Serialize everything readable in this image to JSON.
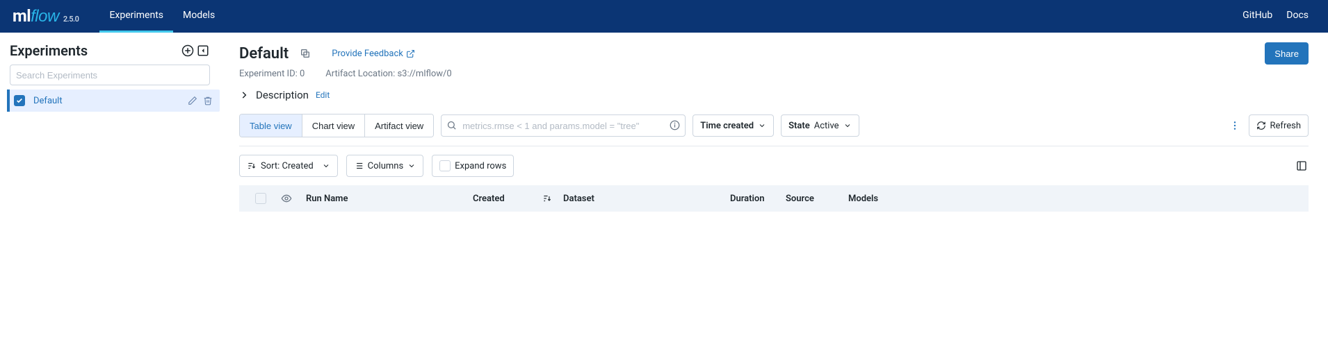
{
  "nav": {
    "version": "2.5.0",
    "tabs": [
      "Experiments",
      "Models"
    ],
    "right": [
      "GitHub",
      "Docs"
    ]
  },
  "sidebar": {
    "title": "Experiments",
    "search_placeholder": "Search Experiments",
    "items": [
      {
        "name": "Default",
        "selected": true
      }
    ]
  },
  "page": {
    "title": "Default",
    "feedback_label": "Provide Feedback",
    "share_label": "Share",
    "meta": {
      "exp_id_label": "Experiment ID: 0",
      "artifact_label": "Artifact Location: s3://mlflow/0"
    },
    "description_label": "Description",
    "description_edit": "Edit"
  },
  "controls": {
    "views": [
      "Table view",
      "Chart view",
      "Artifact view"
    ],
    "active_view": 0,
    "search_placeholder": "metrics.rmse < 1 and params.model = \"tree\"",
    "time_label": "Time created",
    "state_label": "State",
    "state_value": "Active",
    "refresh_label": "Refresh",
    "sort_label": "Sort: Created",
    "columns_label": "Columns",
    "expand_label": "Expand rows"
  },
  "table": {
    "headers": {
      "run_name": "Run Name",
      "created": "Created",
      "dataset": "Dataset",
      "duration": "Duration",
      "source": "Source",
      "models": "Models"
    }
  }
}
